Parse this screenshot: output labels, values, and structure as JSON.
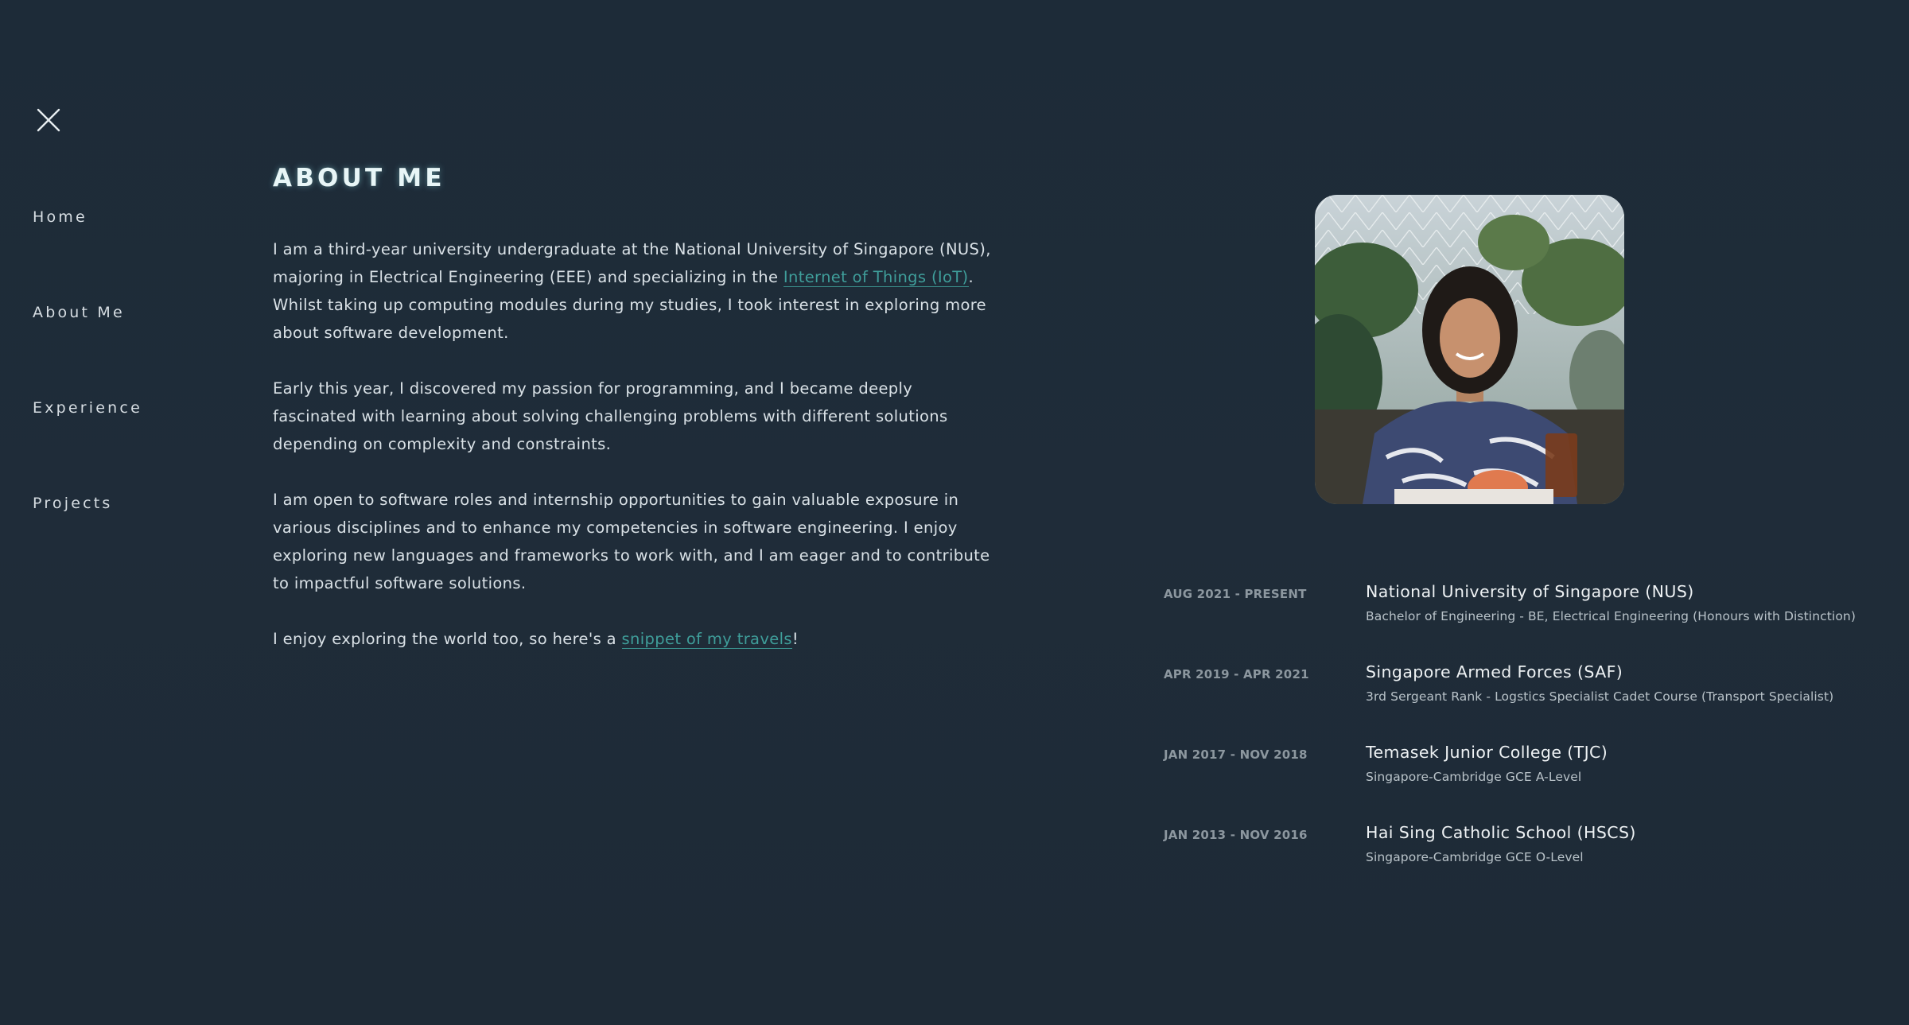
{
  "nav": {
    "close_icon": "close-icon",
    "items": [
      {
        "label": "Home"
      },
      {
        "label": "About Me"
      },
      {
        "label": "Experience"
      },
      {
        "label": "Projects"
      }
    ]
  },
  "about": {
    "title": "ABOUT ME",
    "p1_before": "I am a third-year university undergraduate at the National University of Singapore (NUS), majoring in Electrical Engineering (EEE) and specializing in the ",
    "p1_link": "Internet of Things (IoT)",
    "p1_after": ". Whilst taking up computing modules during my studies, I took interest in exploring more about software development.",
    "p2": "Early this year, I discovered my passion for programming, and I became deeply fascinated with learning about solving challenging problems with different solutions depending on complexity and constraints.",
    "p3": "I am open to software roles and internship opportunities to gain valuable exposure in various disciplines and to enhance my competencies in software engineering. I enjoy exploring new languages and frameworks to work with, and I am eager and to contribute to impactful software solutions.",
    "p4_before": "I enjoy exploring the world too, so here's a ",
    "p4_link": "snippet of my travels",
    "p4_after": "!"
  },
  "colors": {
    "background": "#1f2c39",
    "accent_link": "#3f9e9a",
    "title_glow": "#96ebf0"
  },
  "timeline": [
    {
      "date": "AUG 2021 - PRESENT",
      "org": "National University of Singapore (NUS)",
      "desc": "Bachelor of Engineering - BE, Electrical Engineering (Honours with Distinction)"
    },
    {
      "date": "APR 2019 - APR 2021",
      "org": "Singapore Armed Forces (SAF)",
      "desc": "3rd Sergeant Rank - Logstics Specialist Cadet Course (Transport Specialist)"
    },
    {
      "date": "JAN 2017 - NOV 2018",
      "org": "Temasek Junior College (TJC)",
      "desc": "Singapore-Cambridge GCE A-Level"
    },
    {
      "date": "JAN 2013 - NOV 2016",
      "org": "Hai Sing Catholic School (HSCS)",
      "desc": "Singapore-Cambridge GCE O-Level"
    }
  ]
}
